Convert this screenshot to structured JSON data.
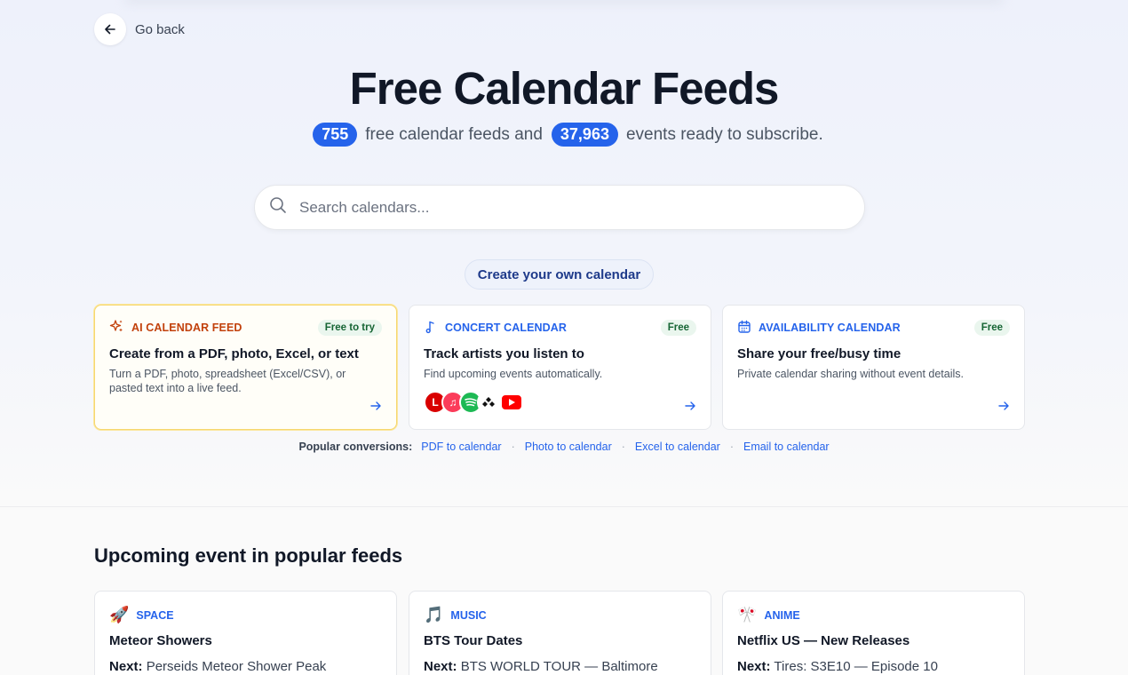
{
  "nav": {
    "go_back": "Go back"
  },
  "hero": {
    "title": "Free Calendar Feeds",
    "feeds_count": "755",
    "feeds_text": "free calendar feeds and",
    "events_count": "37,963",
    "events_text": "events ready to subscribe."
  },
  "search": {
    "placeholder": "Search calendars..."
  },
  "create_button": "Create your own calendar",
  "cards": [
    {
      "tag": "AI CALENDAR FEED",
      "badge": "Free to try",
      "title": "Create from a PDF, photo, Excel, or text",
      "desc": "Turn a PDF, photo, spreadsheet (Excel/CSV), or pasted text into a live feed."
    },
    {
      "tag": "CONCERT CALENDAR",
      "badge": "Free",
      "title": "Track artists you listen to",
      "desc": "Find upcoming events automatically."
    },
    {
      "tag": "AVAILABILITY CALENDAR",
      "badge": "Free",
      "title": "Share your free/busy time",
      "desc": "Private calendar sharing without event details."
    }
  ],
  "colors": {
    "accent": "#2563eb",
    "ai_orange": "#c2410c",
    "badge_green": "#166534",
    "ai_border": "#f6d76f"
  },
  "popular": {
    "label": "Popular conversions:",
    "links": [
      "PDF to calendar",
      "Photo to calendar",
      "Excel to calendar",
      "Email to calendar"
    ]
  },
  "upcoming": {
    "title": "Upcoming event in popular feeds",
    "next_label": "Next:",
    "items": [
      {
        "emoji": "🚀",
        "category": "SPACE",
        "title": "Meteor Showers",
        "next": "Perseids Meteor Shower Peak"
      },
      {
        "emoji": "🎵",
        "category": "MUSIC",
        "title": "BTS Tour Dates",
        "next": "BTS WORLD TOUR — Baltimore"
      },
      {
        "emoji": "🎌",
        "category": "ANIME",
        "title": "Netflix US — New Releases",
        "next": "Tires: S3E10 — Episode 10"
      }
    ]
  }
}
